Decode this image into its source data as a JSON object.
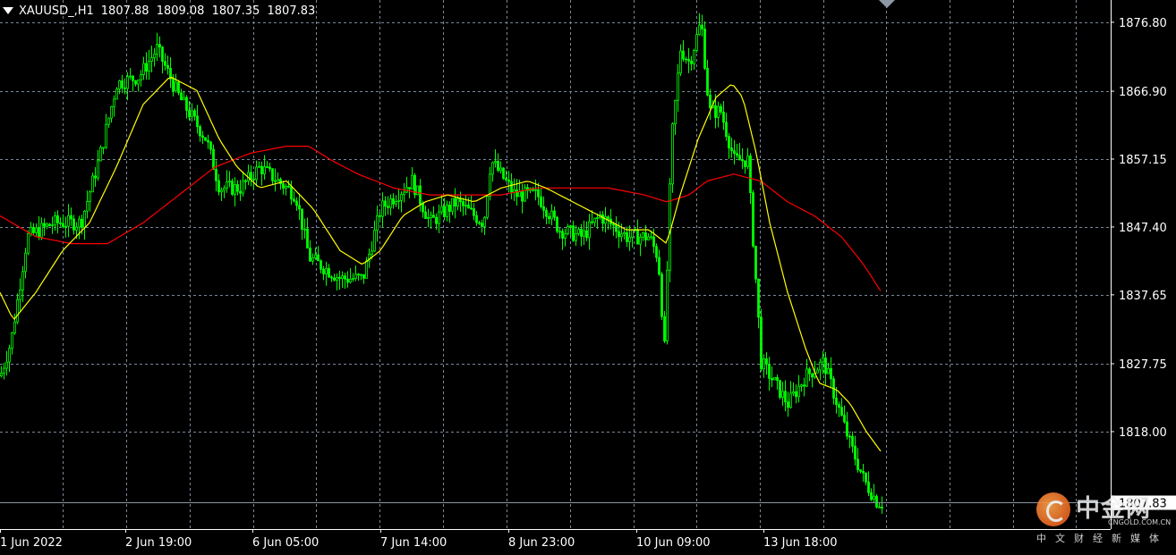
{
  "header": {
    "symbol": "XAUUSD_,H1",
    "open": "1807.88",
    "high": "1809.08",
    "low": "1807.35",
    "close": "1807.83"
  },
  "price_axis": {
    "labels": [
      "1876.80",
      "1866.90",
      "1857.15",
      "1847.40",
      "1837.65",
      "1827.75",
      "1818.00"
    ],
    "current_price_tag": "1807.83"
  },
  "time_axis": {
    "labels": [
      "1 Jun 2022",
      "2 Jun 19:00",
      "6 Jun 05:00",
      "7 Jun 14:00",
      "8 Jun 23:00",
      "10 Jun 09:00",
      "13 Jun 18:00"
    ]
  },
  "watermark": {
    "name": "中金网",
    "url": "CNGOLD.COM.CN",
    "tagline": "中文财经新媒体"
  },
  "colors": {
    "background": "#000000",
    "candles": "#00ff00",
    "fast_ma": "#ffff00",
    "slow_ma": "#ff0000",
    "grid": "#7a8796",
    "axis_text": "#ffffff"
  },
  "chart_data": {
    "type": "candlestick",
    "interval": "H1",
    "y_range": [
      1804,
      1880
    ],
    "close_path_anchors": [
      [
        0,
        1826
      ],
      [
        12,
        1831
      ],
      [
        30,
        1846
      ],
      [
        60,
        1848
      ],
      [
        90,
        1848
      ],
      [
        110,
        1857
      ],
      [
        130,
        1868
      ],
      [
        155,
        1869
      ],
      [
        175,
        1873
      ],
      [
        200,
        1866
      ],
      [
        230,
        1860
      ],
      [
        245,
        1853
      ],
      [
        268,
        1853
      ],
      [
        290,
        1856
      ],
      [
        330,
        1852
      ],
      [
        345,
        1843
      ],
      [
        380,
        1840
      ],
      [
        405,
        1840
      ],
      [
        425,
        1850
      ],
      [
        460,
        1854
      ],
      [
        480,
        1848
      ],
      [
        510,
        1851
      ],
      [
        540,
        1848
      ],
      [
        548,
        1857
      ],
      [
        575,
        1852
      ],
      [
        600,
        1852
      ],
      [
        625,
        1847
      ],
      [
        650,
        1846
      ],
      [
        670,
        1849
      ],
      [
        700,
        1846
      ],
      [
        725,
        1846
      ],
      [
        735,
        1843
      ],
      [
        742,
        1830
      ],
      [
        750,
        1860
      ],
      [
        760,
        1873
      ],
      [
        770,
        1871
      ],
      [
        783,
        1877
      ],
      [
        792,
        1864
      ],
      [
        805,
        1864
      ],
      [
        820,
        1857
      ],
      [
        835,
        1857
      ],
      [
        845,
        1838
      ],
      [
        850,
        1828
      ],
      [
        880,
        1822
      ],
      [
        900,
        1826
      ],
      [
        920,
        1828
      ],
      [
        935,
        1822
      ],
      [
        950,
        1816
      ],
      [
        965,
        1811
      ],
      [
        980,
        1807.83
      ]
    ],
    "fast_ma_anchors": [
      [
        0,
        1838
      ],
      [
        15,
        1834
      ],
      [
        40,
        1838
      ],
      [
        70,
        1844
      ],
      [
        100,
        1848
      ],
      [
        130,
        1856
      ],
      [
        160,
        1865
      ],
      [
        190,
        1869
      ],
      [
        220,
        1867
      ],
      [
        245,
        1860
      ],
      [
        265,
        1856
      ],
      [
        290,
        1853
      ],
      [
        320,
        1854
      ],
      [
        350,
        1850
      ],
      [
        380,
        1844
      ],
      [
        405,
        1842
      ],
      [
        425,
        1844
      ],
      [
        450,
        1849
      ],
      [
        475,
        1851
      ],
      [
        500,
        1852
      ],
      [
        530,
        1851
      ],
      [
        560,
        1853
      ],
      [
        590,
        1854
      ],
      [
        610,
        1853
      ],
      [
        640,
        1851
      ],
      [
        670,
        1849
      ],
      [
        700,
        1847
      ],
      [
        725,
        1847
      ],
      [
        745,
        1845
      ],
      [
        760,
        1852
      ],
      [
        780,
        1860
      ],
      [
        800,
        1866
      ],
      [
        818,
        1868
      ],
      [
        830,
        1866
      ],
      [
        845,
        1858
      ],
      [
        860,
        1848
      ],
      [
        880,
        1838
      ],
      [
        900,
        1830
      ],
      [
        915,
        1825
      ],
      [
        935,
        1824
      ],
      [
        950,
        1822
      ],
      [
        968,
        1818
      ],
      [
        985,
        1815
      ]
    ],
    "slow_ma_anchors": [
      [
        0,
        1849
      ],
      [
        40,
        1846
      ],
      [
        80,
        1845
      ],
      [
        120,
        1845
      ],
      [
        160,
        1848
      ],
      [
        200,
        1852
      ],
      [
        240,
        1856
      ],
      [
        280,
        1858
      ],
      [
        320,
        1859
      ],
      [
        345,
        1859
      ],
      [
        370,
        1857
      ],
      [
        400,
        1855
      ],
      [
        440,
        1853
      ],
      [
        480,
        1852
      ],
      [
        520,
        1852
      ],
      [
        560,
        1852
      ],
      [
        600,
        1853
      ],
      [
        640,
        1853
      ],
      [
        680,
        1853
      ],
      [
        720,
        1852
      ],
      [
        745,
        1851
      ],
      [
        770,
        1852
      ],
      [
        790,
        1854
      ],
      [
        820,
        1855
      ],
      [
        850,
        1854
      ],
      [
        880,
        1851
      ],
      [
        910,
        1849
      ],
      [
        940,
        1846
      ],
      [
        965,
        1842
      ],
      [
        985,
        1838
      ]
    ]
  }
}
